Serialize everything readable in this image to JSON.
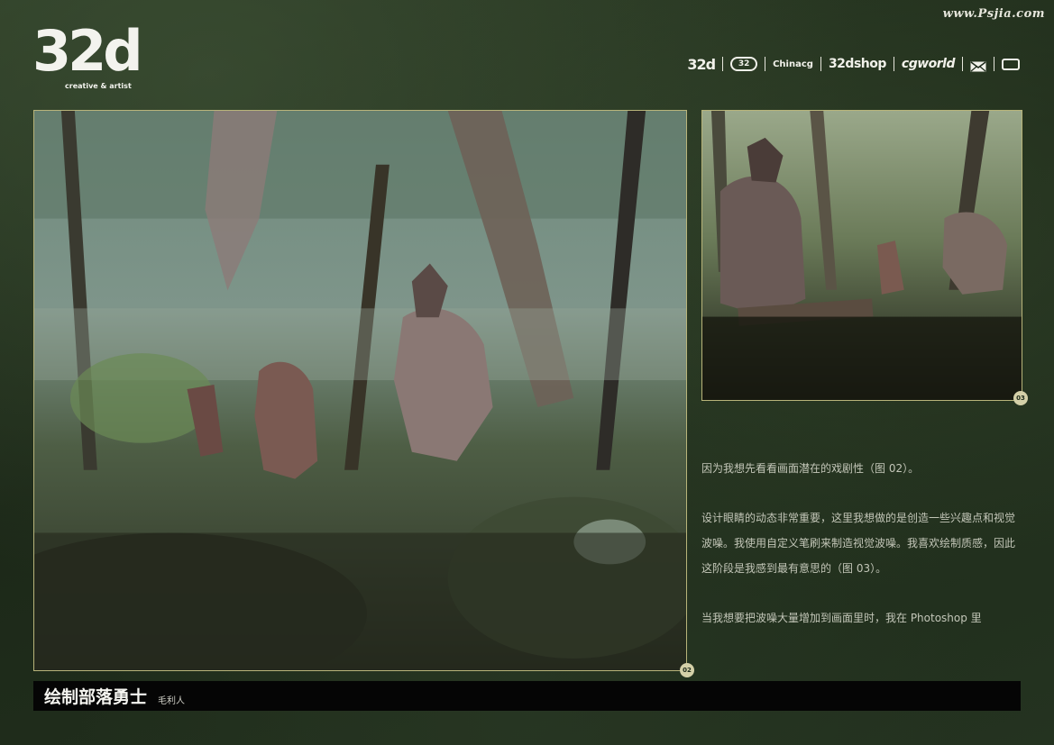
{
  "header": {
    "watermark": "www.Psjia.com",
    "logo": {
      "text": "32d",
      "tagline": "creative & artist"
    },
    "brands": [
      {
        "name": "32d"
      },
      {
        "name": "32d-circle-logo"
      },
      {
        "name": "Chinacg"
      },
      {
        "name": "32dshop"
      },
      {
        "name": "cgworld"
      }
    ]
  },
  "figures": {
    "main": {
      "badge": "02"
    },
    "side": {
      "badge": "03"
    }
  },
  "body": {
    "paragraphs": [
      "因为我想先看看画面潜在的戏剧性（图 02）。",
      "设计眼睛的动态非常重要，这里我想做的是创造一些兴趣点和视觉波噪。我使用自定义笔刷来制造视觉波噪。我喜欢绘制质感，因此这阶段是我感到最有意思的（图 03）。",
      "当我想要把波噪大量增加到画面里时，我在 Photoshop 里"
    ]
  },
  "footer": {
    "title": "绘制部落勇士",
    "author": "毛利人"
  },
  "colors": {
    "background": "#1d2a1a",
    "frame_border": "#b8b47a",
    "badge": "#d4d0a8",
    "title_bar": "#050505"
  }
}
